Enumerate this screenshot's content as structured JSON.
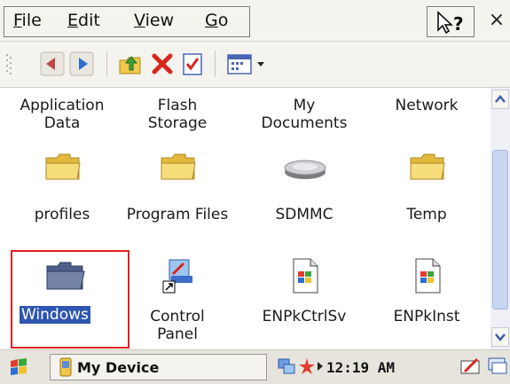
{
  "menu": {
    "file": {
      "first": "F",
      "rest": "ile"
    },
    "edit": {
      "first": "E",
      "rest": "dit"
    },
    "view": {
      "first": "V",
      "rest": "iew"
    },
    "go": {
      "first": "G",
      "rest": "o"
    },
    "help_label": "?",
    "close_label": "×"
  },
  "toolbar": {
    "icons": [
      "back-icon",
      "forward-icon",
      "up-folder-icon",
      "delete-icon",
      "properties-icon",
      "views-icon"
    ]
  },
  "items": [
    {
      "label_line1": "Application",
      "label_line2": "Data",
      "icon": "none"
    },
    {
      "label_line1": "Flash",
      "label_line2": "Storage",
      "icon": "none"
    },
    {
      "label_line1": "My",
      "label_line2": "Documents",
      "icon": "none"
    },
    {
      "label_line1": "Network",
      "label_line2": "",
      "icon": "none"
    },
    {
      "label_line1": "profiles",
      "icon": "folder-icon"
    },
    {
      "label_line1": "Program Files",
      "icon": "folder-icon"
    },
    {
      "label_line1": "SDMMC",
      "icon": "storage-card-icon"
    },
    {
      "label_line1": "Temp",
      "icon": "folder-icon"
    },
    {
      "label_line1": "Windows",
      "icon": "folder-icon",
      "selected": true
    },
    {
      "label_line1": "Control",
      "label_line2": "Panel",
      "icon": "control-panel-shortcut-icon"
    },
    {
      "label_line1": "ENPkCtrlSv",
      "icon": "file-icon"
    },
    {
      "label_line1": "ENPkInst",
      "icon": "file-icon"
    }
  ],
  "taskbar": {
    "task_label": "My Device",
    "clock": "12:19 AM"
  },
  "colors": {
    "selection": "#2e56b0",
    "highlight_border": "#e02020",
    "folder": "#f5d76e"
  }
}
